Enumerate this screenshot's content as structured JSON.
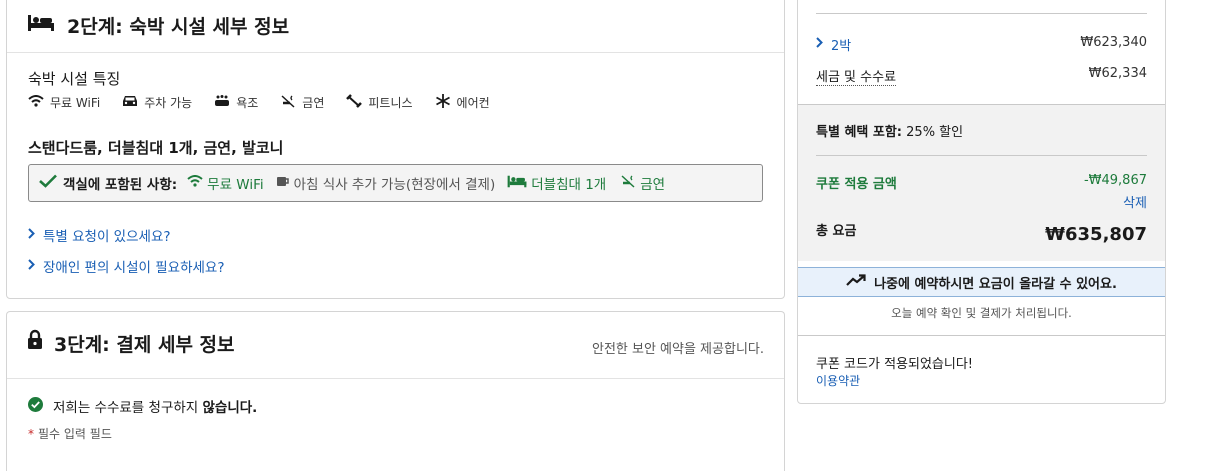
{
  "step2": {
    "title": "2단계: 숙박 시설 세부 정보",
    "features_heading": "숙박 시설 특징",
    "amenities": [
      {
        "icon": "wifi-icon",
        "label": "무료 WiFi"
      },
      {
        "icon": "car-icon",
        "label": "주차 가능"
      },
      {
        "icon": "bathtub-icon",
        "label": "욕조"
      },
      {
        "icon": "no-smoking-icon",
        "label": "금연"
      },
      {
        "icon": "dumbbell-icon",
        "label": "피트니스"
      },
      {
        "icon": "snowflake-icon",
        "label": "에어컨"
      }
    ],
    "room_title": "스탠다드룸, 더블침대 1개, 금연, 발코니",
    "included_label": "객실에 포함된 사항:",
    "included_wifi": "무료 WiFi",
    "included_breakfast": "아침 식사 추가 가능(현장에서 결제)",
    "included_bed": "더블침대 1개",
    "included_nosmoking": "금연",
    "special_request": "특별 요청이 있으세요?",
    "accessibility": "장애인 편의 시설이 필요하세요?"
  },
  "step3": {
    "title": "3단계: 결제 세부 정보",
    "secure_note": "안전한 보안 예약을 제공합니다.",
    "no_fee_prefix": "저희는 수수료를 청구하지 ",
    "no_fee_bold": "않습니다.",
    "required_star": "*",
    "required_note": "필수 입력 필드"
  },
  "summary": {
    "nights_label": "2박",
    "nights_price": "₩623,340",
    "tax_label": "세금 및 수수료",
    "tax_price": "₩62,334",
    "benefit_prefix": "특별 혜택 포함:",
    "benefit_value": "25% 할인",
    "coupon_label": "쿠폰 적용 금액",
    "coupon_value": "-₩49,867",
    "delete_label": "삭제",
    "total_label": "총 요금",
    "total_value": "₩635,807",
    "price_warning": "나중에 예약하시면 요금이 올라갈 수 있어요.",
    "payment_note": "오늘 예약 확인 및 결제가 처리됩니다.",
    "coupon_applied": "쿠폰 코드가 적용되었습니다!",
    "terms_link": "이용약관"
  },
  "colors": {
    "green": "#1e7b3c",
    "link": "#1a5fb4",
    "red": "#c62828"
  }
}
